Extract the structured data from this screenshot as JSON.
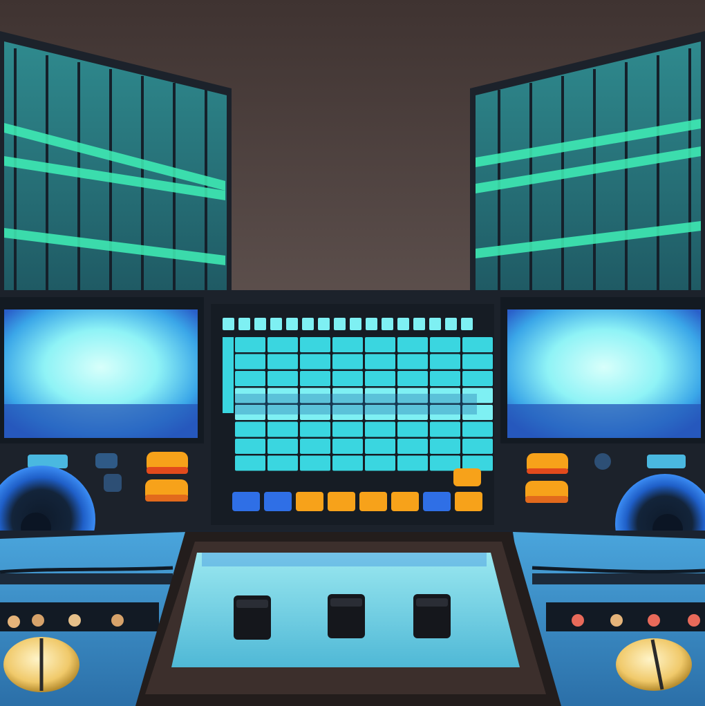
{
  "scene": {
    "subject": "music-studio-console",
    "colors": {
      "wall": "#5a4c49",
      "wall_top": "#3f3331",
      "panel_dark": "#1c222b",
      "panel_mid": "#25323f",
      "screen_glow": "#8ff3f6",
      "screen_edge": "#2a7fd9",
      "pad_cyan": "#3ad6e0",
      "pad_cyan_light": "#7ef0f3",
      "meter_teal": "#2f8a8e",
      "meter_green": "#3ff0b6",
      "btn_orange": "#f7a21a",
      "btn_red": "#e24a1c",
      "btn_blue": "#2f6fe6",
      "desk_blue": "#3c8fd0",
      "knob_gold": "#f6d98a",
      "speaker_blue": "#2d7be8"
    },
    "pad_grid": {
      "top_row_count": 16,
      "columns": 8,
      "rows": 8
    },
    "bottom_buttons": [
      "blue",
      "blue",
      "orange",
      "orange",
      "orange",
      "orange",
      "blue",
      "orange"
    ],
    "fader_count": 3
  }
}
